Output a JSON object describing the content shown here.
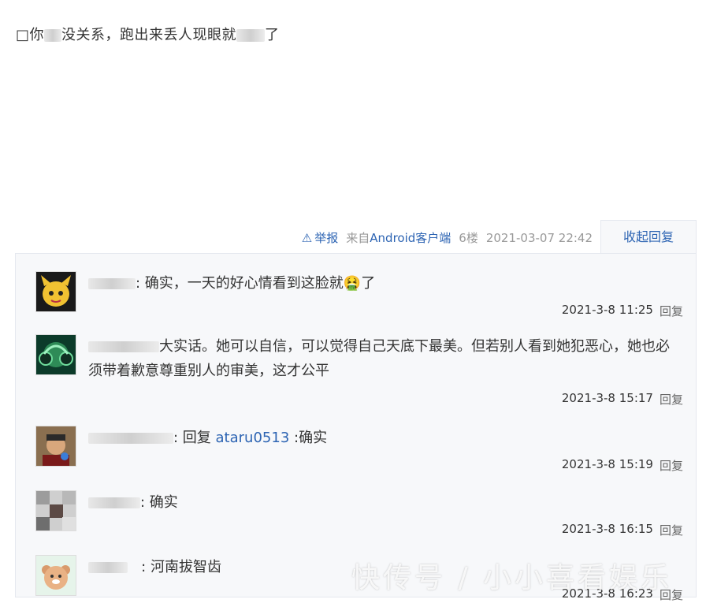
{
  "post": {
    "prefix": "□你",
    "text": "没关系，跑出来丢人现眼就",
    "suffix": "了"
  },
  "meta": {
    "report_label": "举报",
    "source": "来自Android客户端",
    "floor": "6楼",
    "datetime": "2021-03-07 22:42",
    "collapse_label": "收起回复"
  },
  "replies": [
    {
      "avatar": "yellow-cartoon-avatar",
      "text": "确实，一天的好心情看到这脸就🤮了",
      "time": "2021-3-8 11:25",
      "reply": "回复"
    },
    {
      "avatar": "green-headphone-avatar",
      "text": "大实话。她可以自信，可以觉得自己天底下最美。但若别人看到她犯恶心，她也必须带着歉意尊重别人的审美，这才公平",
      "time": "2021-3-8 15:17",
      "reply": "回复"
    },
    {
      "avatar": "man-portrait-avatar",
      "pre": "回复 ",
      "mention": "ataru0513",
      "text": " :确实",
      "time": "2021-3-8 15:19",
      "reply": "回复"
    },
    {
      "avatar": "pixelated-avatar",
      "text": "确实",
      "time": "2021-3-8 16:15",
      "reply": "回复"
    },
    {
      "avatar": "bear-avatar",
      "text": "河南拔智齿",
      "time": "2021-3-8 16:23",
      "reply": "回复"
    }
  ],
  "watermark": "快传号 / 小小喜看娱乐"
}
